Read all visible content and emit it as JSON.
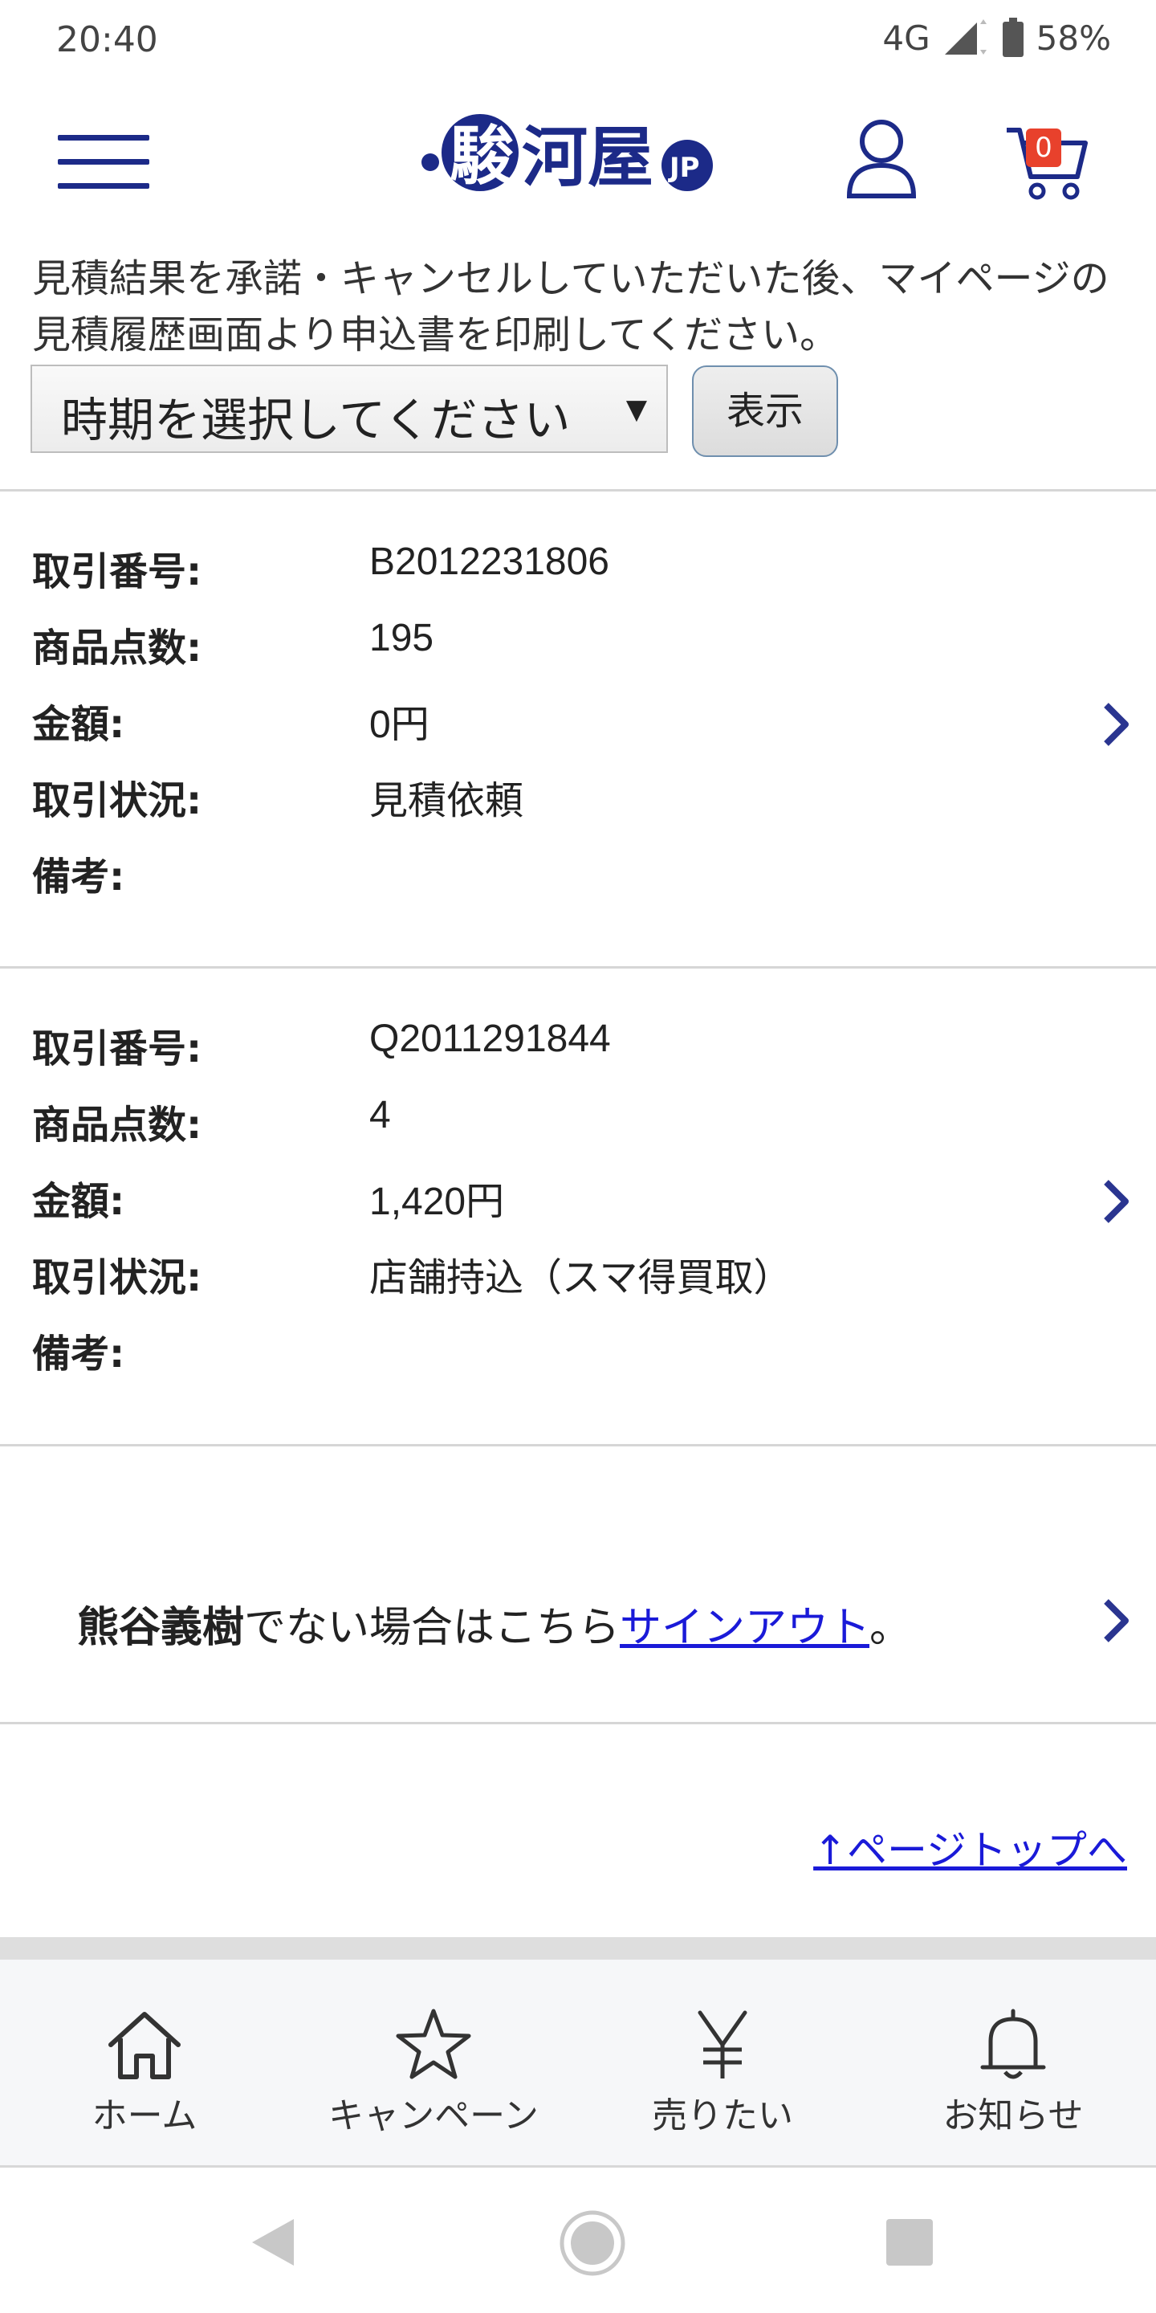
{
  "status_bar": {
    "time": "20:40",
    "network": "4G",
    "battery": "58%"
  },
  "header": {
    "logo": "駿河屋JP",
    "cart_count": "0"
  },
  "notice": "見積結果を承諾・キャンセルしていただいた後、マイページの見積履歴画面より申込書を印刷してください。",
  "period_select": {
    "value": "時期を選択してください",
    "arrow": "▼"
  },
  "show_button": "表示",
  "labels": {
    "number": "取引番号:",
    "count": "商品点数:",
    "amount": "金額:",
    "status": "取引状況:",
    "note": "備考:"
  },
  "transactions": [
    {
      "number": "B2012231806",
      "count": "195",
      "amount": "0円",
      "status": "見積依頼",
      "note": ""
    },
    {
      "number": "Q2011291844",
      "count": "4",
      "amount": "1,420円",
      "status": "店舗持込（スマ得買取）",
      "note": ""
    }
  ],
  "signout": {
    "name": "熊谷義樹",
    "middle": "でない場合はこちら",
    "link": "サインアウト",
    "end": "。"
  },
  "page_top": "↑ページトップへ",
  "bottom_nav": [
    {
      "label": "ホーム",
      "icon": "home-icon"
    },
    {
      "label": "キャンペーン",
      "icon": "star-icon"
    },
    {
      "label": "売りたい",
      "icon": "yen-icon"
    },
    {
      "label": "お知らせ",
      "icon": "bell-icon"
    }
  ],
  "colors": {
    "brand": "#1c2a88",
    "link": "#1a1ad8",
    "badge": "#e8412c"
  }
}
